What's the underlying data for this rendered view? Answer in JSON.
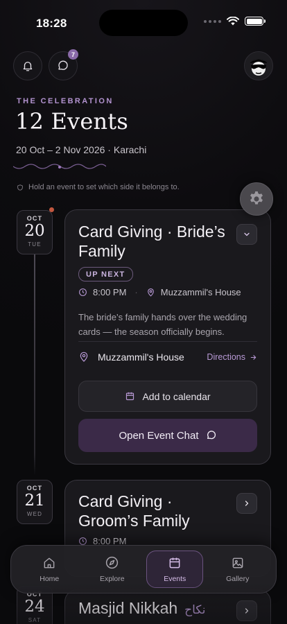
{
  "status": {
    "time": "18:28"
  },
  "header": {
    "chat_badge": "7",
    "eyebrow": "THE CELEBRATION",
    "title": "12 Events",
    "dates": "20 Oct – 2 Nov 2026 · Karachi",
    "hint": "Hold an event to set which side it belongs to."
  },
  "events": [
    {
      "month": "OCT",
      "day": "20",
      "weekday": "TUE",
      "title_line1": "Card Giving · Bride’s",
      "title_line2": "Family",
      "tag": "UP NEXT",
      "time": "8:00 PM",
      "venue": "Muzzammil's House",
      "description": "The bride’s family hands over the wedding cards — the season officially begins.",
      "location": "Muzzammil's House",
      "directions_label": "Directions",
      "calendar_label": "Add to calendar",
      "chat_label": "Open Event Chat"
    },
    {
      "month": "OCT",
      "day": "21",
      "weekday": "WED",
      "title_line1": "Card Giving ·",
      "title_line2": "Groom’s Family",
      "time": "8:00 PM"
    },
    {
      "month": "OCT",
      "day": "24",
      "weekday": "SAT",
      "title_line1": "Masjid Nikkah",
      "title_urdu": "نکاح"
    }
  ],
  "nav": {
    "items": [
      {
        "label": "Home",
        "icon": "home-icon"
      },
      {
        "label": "Explore",
        "icon": "compass-icon"
      },
      {
        "label": "Events",
        "icon": "calendar-icon",
        "active": true
      },
      {
        "label": "Gallery",
        "icon": "image-icon"
      }
    ]
  },
  "colors": {
    "accent": "#b99ad6",
    "chat_button": "#3b2a48",
    "badge": "#8a6aa8",
    "event_dot": "#c2573f"
  }
}
